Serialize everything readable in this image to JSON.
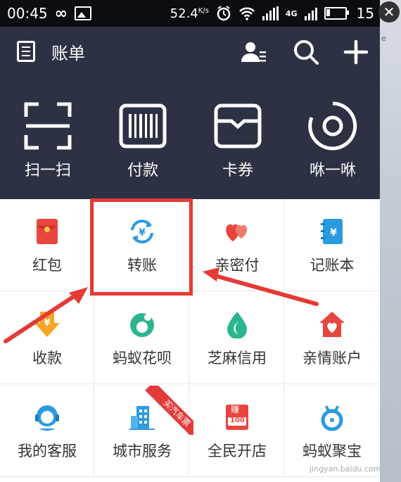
{
  "status_bar": {
    "time": "00:45",
    "infinity": "∞",
    "speed": "52.4",
    "speed_unit": "K/s",
    "network": "4G",
    "battery_level": "15"
  },
  "header": {
    "title": "账单"
  },
  "quick_actions": [
    {
      "label": "扫一扫",
      "icon": "scan-icon"
    },
    {
      "label": "付款",
      "icon": "barcode-icon"
    },
    {
      "label": "卡券",
      "icon": "card-wallet-icon"
    },
    {
      "label": "咻一咻",
      "icon": "ripple-icon"
    }
  ],
  "grid": [
    {
      "label": "红包",
      "icon": "red-envelope-icon"
    },
    {
      "label": "转账",
      "icon": "transfer-icon"
    },
    {
      "label": "亲密付",
      "icon": "hearts-icon"
    },
    {
      "label": "记账本",
      "icon": "ledger-icon"
    },
    {
      "label": "收款",
      "icon": "receive-money-icon"
    },
    {
      "label": "蚂蚁花呗",
      "icon": "huabei-icon"
    },
    {
      "label": "芝麻信用",
      "icon": "sesame-credit-icon"
    },
    {
      "label": "亲情账户",
      "icon": "family-account-icon"
    },
    {
      "label": "我的客服",
      "icon": "customer-service-icon"
    },
    {
      "label": "城市服务",
      "icon": "city-service-icon"
    },
    {
      "label": "全民开店",
      "icon": "open-shop-icon"
    },
    {
      "label": "蚂蚁聚宝",
      "icon": "jubao-icon"
    }
  ],
  "ribbon_text": "买汽车票",
  "shop_badge": {
    "top": "赚",
    "bottom": "100"
  },
  "watermark": "jingyan.baidu.com",
  "colors": {
    "header_bg": "#2c3244",
    "highlight": "#e53a35",
    "red": "#e9453f",
    "teal": "#2bb58f",
    "blue": "#2a9be0"
  }
}
